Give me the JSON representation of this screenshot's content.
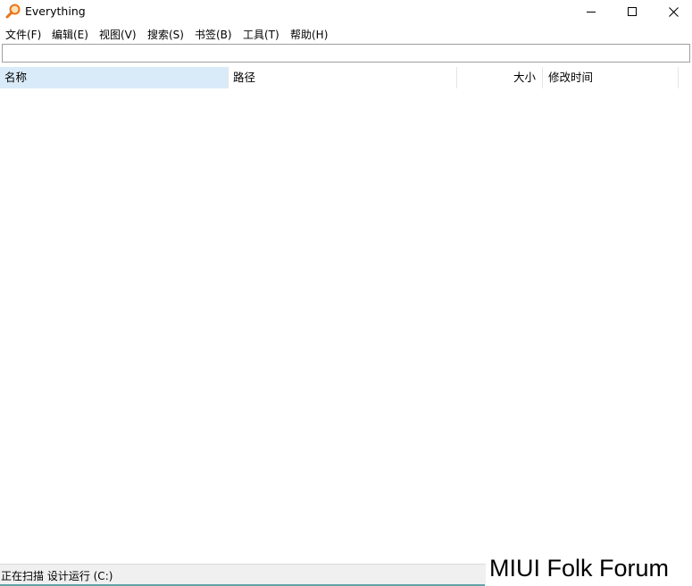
{
  "window": {
    "title": "Everything"
  },
  "menu": {
    "items": [
      "文件(F)",
      "编辑(E)",
      "视图(V)",
      "搜索(S)",
      "书签(B)",
      "工具(T)",
      "帮助(H)"
    ]
  },
  "search": {
    "value": "",
    "placeholder": ""
  },
  "columns": {
    "name": "名称",
    "path": "路径",
    "size": "大小",
    "modified": "修改时间"
  },
  "results": [],
  "status": {
    "text": "正在扫描 设计运行 (C:)"
  },
  "watermark": {
    "text": "MIUI Folk Forum"
  },
  "colors": {
    "accent": "#63a3a8",
    "header_active": "#d9ebf9",
    "icon_orange": "#e8741a"
  }
}
